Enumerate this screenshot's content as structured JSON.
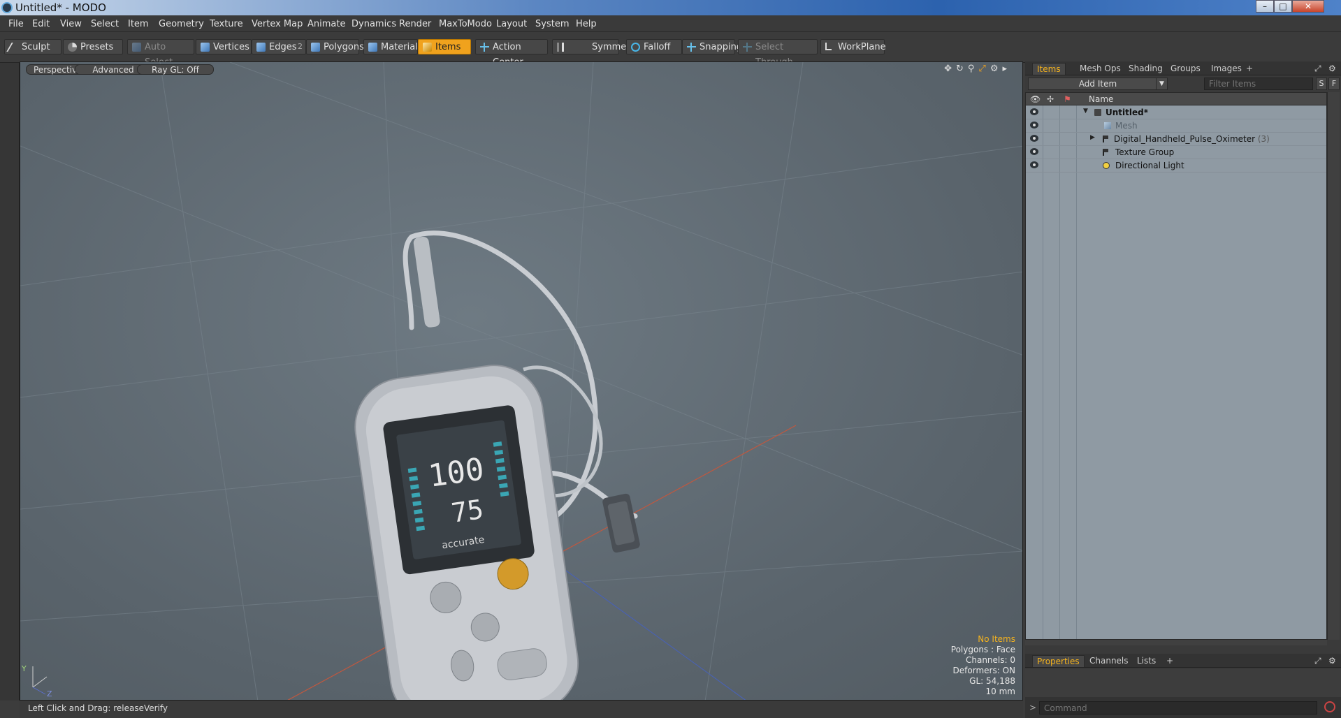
{
  "window": {
    "title": "Untitled* - MODO",
    "minimize": "–",
    "maximize": "□",
    "close": "✕"
  },
  "menu": [
    "File",
    "Edit",
    "View",
    "Select",
    "Item",
    "Geometry",
    "Texture",
    "Vertex Map",
    "Animate",
    "Dynamics",
    "Render",
    "MaxToModo",
    "Layout",
    "System",
    "Help"
  ],
  "toolbar": {
    "sculpt": "Sculpt",
    "presets": "Presets",
    "auto_select": "Auto Select",
    "vertices": "Vertices",
    "edges": "Edges",
    "edges_count": "2",
    "polygons": "Polygons",
    "materials": "Materials",
    "items": "Items",
    "action_center": "Action Center",
    "symmetry": "Symmetry",
    "falloff": "Falloff",
    "snapping": "Snapping",
    "select_through": "Select Through",
    "workplane": "WorkPlane"
  },
  "viewport": {
    "tabs": [
      "Perspective",
      "Advanced",
      "Ray GL: Off"
    ],
    "stats": {
      "selection": "No Items",
      "polygons": "Polygons : Face",
      "channels": "Channels: 0",
      "deformers": "Deformers: ON",
      "gl": "GL: 54,188",
      "scale": "10 mm"
    },
    "screen_readout": {
      "big": "100",
      "small": "75",
      "brand": "accurate"
    },
    "axes": {
      "y": "Y",
      "z": "Z"
    }
  },
  "status": {
    "hint": "Left Click and Drag:  releaseVerify"
  },
  "items_panel": {
    "tabs": [
      "Items",
      "Mesh Ops",
      "Shading",
      "Groups",
      "Images",
      "+"
    ],
    "add_item": "Add Item",
    "filter_placeholder": "Filter Items",
    "s_button": "S",
    "f_button": "F",
    "column_name": "Name",
    "rows": [
      {
        "name": "Untitled*"
      },
      {
        "name": "Mesh"
      },
      {
        "name": "Digital_Handheld_Pulse_Oximeter",
        "count": "(3)"
      },
      {
        "name": "Texture Group"
      },
      {
        "name": "Directional Light"
      }
    ]
  },
  "props_panel": {
    "tabs": [
      "Properties",
      "Channels",
      "Lists",
      "+"
    ]
  },
  "command": {
    "prompt": ">",
    "placeholder": "Command"
  },
  "colors": {
    "accent": "#f0a21d",
    "viewport_bg": "#5e6970",
    "list_bg": "#8f9aa3"
  }
}
